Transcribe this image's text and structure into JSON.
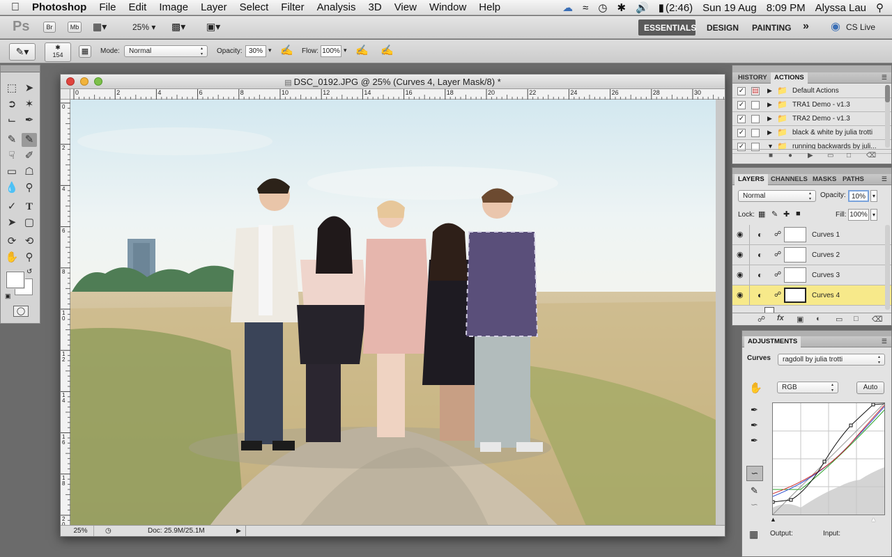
{
  "menubar": {
    "app": "Photoshop",
    "items": [
      "File",
      "Edit",
      "Image",
      "Layer",
      "Select",
      "Filter",
      "Analysis",
      "3D",
      "View",
      "Window",
      "Help"
    ],
    "battery": "(2:46)",
    "date": "Sun 19 Aug",
    "time": "8:09 PM",
    "user": "Alyssa Lau"
  },
  "appbar": {
    "logo": "Ps",
    "bridge": "Br",
    "minibridge": "Mb",
    "zoom": "25%",
    "workspaces": [
      "ESSENTIALS",
      "DESIGN",
      "PAINTING"
    ],
    "more": "»",
    "cslive": "CS Live"
  },
  "options": {
    "brush_size": "154",
    "mode_label": "Mode:",
    "mode_value": "Normal",
    "opacity_label": "Opacity:",
    "opacity_value": "30%",
    "flow_label": "Flow:",
    "flow_value": "100%"
  },
  "document": {
    "title": "DSC_0192.JPG @ 25% (Curves 4, Layer Mask/8) *",
    "h_ruler": [
      "0",
      "2",
      "4",
      "6",
      "8",
      "10",
      "12",
      "14",
      "16",
      "18",
      "20",
      "22",
      "24",
      "26",
      "28",
      "30"
    ],
    "v_ruler": [
      "0",
      "2",
      "4",
      "6",
      "8",
      "1\n0",
      "1\n2",
      "1\n4",
      "1\n6",
      "1\n8",
      "2\n0"
    ],
    "zoom": "25%",
    "doc_size": "Doc: 25.9M/25.1M"
  },
  "history_panel": {
    "tabs": [
      "HISTORY",
      "ACTIONS"
    ],
    "actions": [
      {
        "label": "Default Actions",
        "expanded": false
      },
      {
        "label": "TRA1 Demo - v1.3",
        "expanded": false
      },
      {
        "label": "TRA2 Demo - v1.3",
        "expanded": false
      },
      {
        "label": "black & white by julia trotti",
        "expanded": false
      },
      {
        "label": "running backwards by juli...",
        "expanded": true
      }
    ]
  },
  "layers_panel": {
    "tabs": [
      "LAYERS",
      "CHANNELS",
      "MASKS",
      "PATHS"
    ],
    "blend_mode": "Normal",
    "opacity_label": "Opacity:",
    "opacity_value": "10%",
    "lock_label": "Lock:",
    "fill_label": "Fill:",
    "fill_value": "100%",
    "layers": [
      {
        "name": "Curves 1",
        "selected": false
      },
      {
        "name": "Curves 2",
        "selected": false
      },
      {
        "name": "Curves 3",
        "selected": false
      },
      {
        "name": "Curves 4",
        "selected": true
      }
    ]
  },
  "adjustments_panel": {
    "tab": "ADJUSTMENTS",
    "curves_label": "Curves",
    "preset": "ragdoll by julia trotti",
    "channel": "RGB",
    "auto": "Auto",
    "output_label": "Output:",
    "input_label": "Input:"
  },
  "colors": {
    "selected_layer": "#f7e98a",
    "menubar": "#e9e9e9",
    "accent": "#3b6fb6"
  }
}
